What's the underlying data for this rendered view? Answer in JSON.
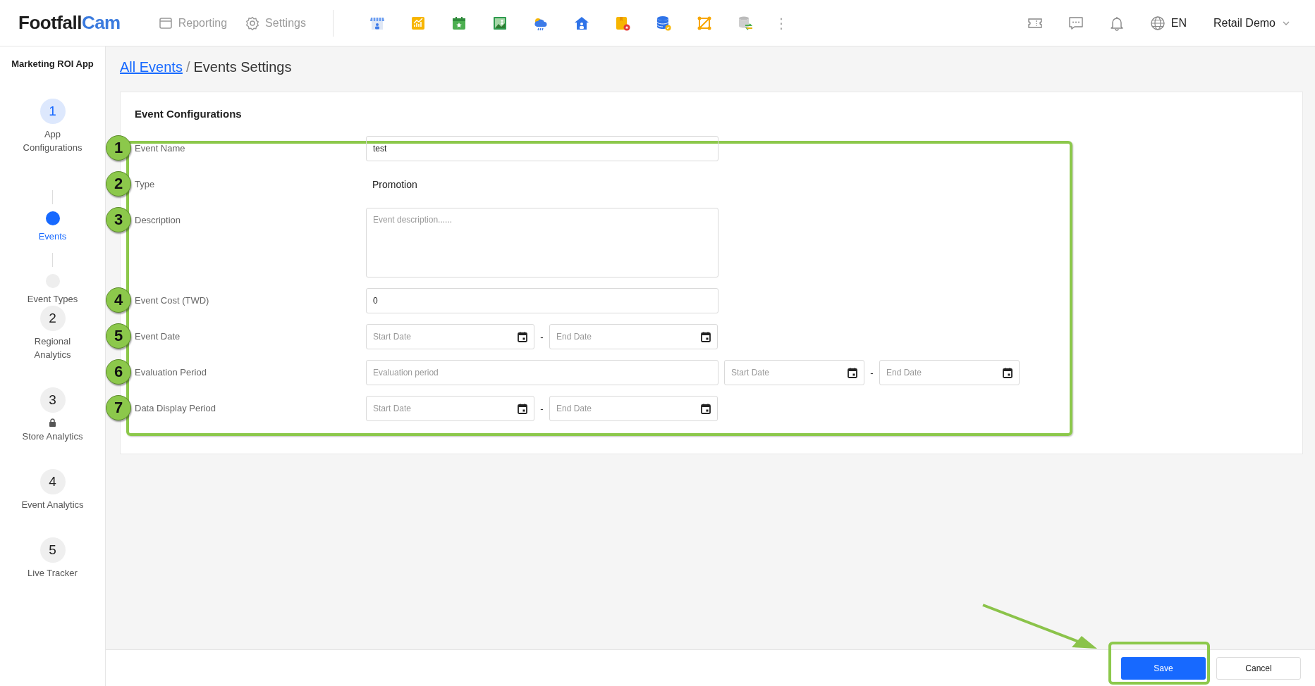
{
  "header": {
    "logo": {
      "dark": "Footfall",
      "accent": "Cam"
    },
    "nav": [
      {
        "label": "Reporting"
      },
      {
        "label": "Settings"
      }
    ],
    "more": "⋮",
    "language": "EN",
    "user": "Retail Demo"
  },
  "sidebar": {
    "title": "Marketing ROI App",
    "steps": [
      {
        "number": "1",
        "label": "App Configurations",
        "selected": true,
        "locked": false,
        "children": [
          {
            "label": "Events",
            "selected": true
          },
          {
            "label": "Event Types",
            "selected": false
          }
        ]
      },
      {
        "number": "2",
        "label": "Regional Analytics",
        "selected": false,
        "locked": false
      },
      {
        "number": "3",
        "label": "Store Analytics",
        "selected": false,
        "locked": true
      },
      {
        "number": "4",
        "label": "Event Analytics",
        "selected": false,
        "locked": false
      },
      {
        "number": "5",
        "label": "Live Tracker",
        "selected": false,
        "locked": false
      }
    ]
  },
  "breadcrumb": {
    "link": "All Events",
    "separator": "/",
    "current": "Events Settings"
  },
  "form": {
    "title": "Event Configurations",
    "rows": [
      {
        "callout": "1",
        "label": "Event Name",
        "kind": "text",
        "value": "test"
      },
      {
        "callout": "2",
        "label": "Type",
        "kind": "static",
        "value": "Promotion"
      },
      {
        "callout": "3",
        "label": "Description",
        "kind": "textarea",
        "placeholder": "Event description......"
      },
      {
        "callout": "4",
        "label": "Event Cost (TWD)",
        "kind": "text",
        "value": "0"
      },
      {
        "callout": "5",
        "label": "Event Date",
        "kind": "date_range",
        "start_placeholder": "Start Date",
        "separator": "-",
        "end_placeholder": "End Date"
      },
      {
        "callout": "6",
        "label": "Evaluation Period",
        "kind": "period",
        "placeholder": "Evaluation period",
        "start_placeholder": "Start Date",
        "separator": "-",
        "end_placeholder": "End Date"
      },
      {
        "callout": "7",
        "label": "Data Display Period",
        "kind": "date_range",
        "start_placeholder": "Start Date",
        "separator": "-",
        "end_placeholder": "End Date"
      }
    ]
  },
  "footer": {
    "buttons": [
      {
        "label": "Save",
        "kind": "primary",
        "highlighted": true
      },
      {
        "label": "Cancel",
        "kind": "secondary",
        "highlighted": false
      }
    ]
  }
}
